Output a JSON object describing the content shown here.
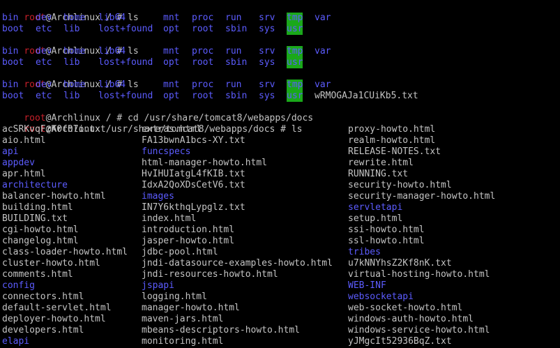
{
  "colors": {
    "background": "#000000",
    "text": "#c4c4c4",
    "prompt_user": "#c8202a",
    "directory": "#5c5cff",
    "sticky_dir_bg": "#1aa81a"
  },
  "prompts": {
    "user": "root",
    "host_home": "@Archlinux / # ",
    "host_docs": "@Archlinux /usr/share/tomcat8/webapps/docs # "
  },
  "commands": {
    "ls": "ls",
    "cd": "cd /usr/share/tomcat8/webapps/docs"
  },
  "root_listing": {
    "row1": [
      "bin",
      "dev",
      "home",
      "lib64",
      "mnt",
      "proc",
      "run",
      "srv",
      "tmp",
      "var"
    ],
    "row2": [
      "boot",
      "etc",
      "lib",
      "lost+found",
      "opt",
      "root",
      "sbin",
      "sys",
      "usr"
    ],
    "extra_file": "wRMOGAJa1CUiKb5.txt"
  },
  "docs_listing": {
    "col1": [
      {
        "name": "acSRKvqFzK0f07o.txt",
        "type": "file"
      },
      {
        "name": "aio.html",
        "type": "file"
      },
      {
        "name": "api",
        "type": "dir"
      },
      {
        "name": "appdev",
        "type": "dir"
      },
      {
        "name": "apr.html",
        "type": "file"
      },
      {
        "name": "architecture",
        "type": "dir"
      },
      {
        "name": "balancer-howto.html",
        "type": "file"
      },
      {
        "name": "building.html",
        "type": "file"
      },
      {
        "name": "BUILDING.txt",
        "type": "file"
      },
      {
        "name": "cgi-howto.html",
        "type": "file"
      },
      {
        "name": "changelog.html",
        "type": "file"
      },
      {
        "name": "class-loader-howto.html",
        "type": "file"
      },
      {
        "name": "cluster-howto.html",
        "type": "file"
      },
      {
        "name": "comments.html",
        "type": "file"
      },
      {
        "name": "config",
        "type": "dir"
      },
      {
        "name": "connectors.html",
        "type": "file"
      },
      {
        "name": "default-servlet.html",
        "type": "file"
      },
      {
        "name": "deployer-howto.html",
        "type": "file"
      },
      {
        "name": "developers.html",
        "type": "file"
      },
      {
        "name": "elapi",
        "type": "dir"
      }
    ],
    "col2": [
      {
        "name": "extras.html",
        "type": "file"
      },
      {
        "name": "FA13bwnA1bcs-XY.txt",
        "type": "file"
      },
      {
        "name": "funcspecs",
        "type": "dir"
      },
      {
        "name": "html-manager-howto.html",
        "type": "file"
      },
      {
        "name": "HvIHUIatgL4fKIB.txt",
        "type": "file"
      },
      {
        "name": "IdxA2QoXDsCetV6.txt",
        "type": "file"
      },
      {
        "name": "images",
        "type": "dir"
      },
      {
        "name": "IN7Y6kthqLypglz.txt",
        "type": "file"
      },
      {
        "name": "index.html",
        "type": "file"
      },
      {
        "name": "introduction.html",
        "type": "file"
      },
      {
        "name": "jasper-howto.html",
        "type": "file"
      },
      {
        "name": "jdbc-pool.html",
        "type": "file"
      },
      {
        "name": "jndi-datasource-examples-howto.html",
        "type": "file"
      },
      {
        "name": "jndi-resources-howto.html",
        "type": "file"
      },
      {
        "name": "jspapi",
        "type": "dir"
      },
      {
        "name": "logging.html",
        "type": "file"
      },
      {
        "name": "manager-howto.html",
        "type": "file"
      },
      {
        "name": "maven-jars.html",
        "type": "file"
      },
      {
        "name": "mbeans-descriptors-howto.html",
        "type": "file"
      },
      {
        "name": "monitoring.html",
        "type": "file"
      }
    ],
    "col3": [
      {
        "name": "proxy-howto.html",
        "type": "file"
      },
      {
        "name": "realm-howto.html",
        "type": "file"
      },
      {
        "name": "RELEASE-NOTES.txt",
        "type": "file"
      },
      {
        "name": "rewrite.html",
        "type": "file"
      },
      {
        "name": "RUNNING.txt",
        "type": "file"
      },
      {
        "name": "security-howto.html",
        "type": "file"
      },
      {
        "name": "security-manager-howto.html",
        "type": "file"
      },
      {
        "name": "servletapi",
        "type": "dir"
      },
      {
        "name": "setup.html",
        "type": "file"
      },
      {
        "name": "ssi-howto.html",
        "type": "file"
      },
      {
        "name": "ssl-howto.html",
        "type": "file"
      },
      {
        "name": "tribes",
        "type": "dir"
      },
      {
        "name": "u7kNNYhsZ2Kf8nK.txt",
        "type": "file"
      },
      {
        "name": "virtual-hosting-howto.html",
        "type": "file"
      },
      {
        "name": "WEB-INF",
        "type": "dir"
      },
      {
        "name": "websocketapi",
        "type": "dir"
      },
      {
        "name": "web-socket-howto.html",
        "type": "file"
      },
      {
        "name": "windows-auth-howto.html",
        "type": "file"
      },
      {
        "name": "windows-service-howto.html",
        "type": "file"
      },
      {
        "name": "yJMgcIt52936BqZ.txt",
        "type": "file"
      }
    ]
  }
}
